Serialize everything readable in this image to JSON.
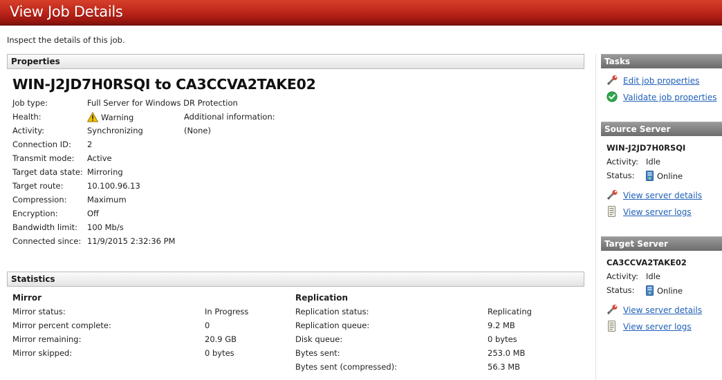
{
  "window": {
    "title": "View Job Details"
  },
  "intro": "Inspect the details of this job.",
  "properties": {
    "header": "Properties",
    "job_name": "WIN-J2JD7H0RSQI to CA3CCVA2TAKE02",
    "rows": [
      {
        "label": "Job type:",
        "value": "Full Server for Windows DR Protection"
      },
      {
        "label": "Health:",
        "value": "Warning",
        "icon": "warning-icon"
      },
      {
        "label": "Activity:",
        "value": "Synchronizing"
      },
      {
        "label": "Connection ID:",
        "value": "2"
      },
      {
        "label": "Transmit mode:",
        "value": "Active"
      },
      {
        "label": "Target data state:",
        "value": "Mirroring"
      },
      {
        "label": "Target route:",
        "value": "10.100.96.13"
      },
      {
        "label": "Compression:",
        "value": "Maximum"
      },
      {
        "label": "Encryption:",
        "value": "Off"
      },
      {
        "label": "Bandwidth limit:",
        "value": "100 Mb/s"
      },
      {
        "label": "Connected since:",
        "value": "11/9/2015 2:32:36 PM"
      }
    ],
    "additional_label": "Additional information:",
    "additional_value": "(None)"
  },
  "statistics": {
    "header": "Statistics",
    "mirror": {
      "title": "Mirror",
      "rows": [
        {
          "label": "Mirror status:",
          "value": "In Progress"
        },
        {
          "label": "Mirror percent complete:",
          "value": "0"
        },
        {
          "label": "Mirror remaining:",
          "value": "20.9 GB"
        },
        {
          "label": "Mirror skipped:",
          "value": "0 bytes"
        }
      ]
    },
    "replication": {
      "title": "Replication",
      "rows": [
        {
          "label": "Replication status:",
          "value": "Replicating"
        },
        {
          "label": "Replication queue:",
          "value": "9.2 MB"
        },
        {
          "label": "Disk queue:",
          "value": "0 bytes"
        },
        {
          "label": "Bytes sent:",
          "value": "253.0 MB"
        },
        {
          "label": "Bytes sent (compressed):",
          "value": "56.3 MB"
        }
      ]
    }
  },
  "tasks": {
    "header": "Tasks",
    "links": [
      {
        "label": "Edit job properties",
        "icon": "wrench-icon"
      },
      {
        "label": "Validate job properties",
        "icon": "check-icon"
      }
    ]
  },
  "source_server": {
    "header": "Source Server",
    "name": "WIN-J2JD7H0RSQI",
    "activity_label": "Activity:",
    "activity": "Idle",
    "status_label": "Status:",
    "status": "Online",
    "links": [
      {
        "label": "View server details",
        "icon": "wrench-icon"
      },
      {
        "label": "View server logs",
        "icon": "log-icon"
      }
    ]
  },
  "target_server": {
    "header": "Target Server",
    "name": "CA3CCVA2TAKE02",
    "activity_label": "Activity:",
    "activity": "Idle",
    "status_label": "Status:",
    "status": "Online",
    "links": [
      {
        "label": "View server details",
        "icon": "wrench-icon"
      },
      {
        "label": "View server logs",
        "icon": "log-icon"
      }
    ]
  },
  "colors": {
    "title_bar": "#c0281b",
    "link": "#1f5fb8",
    "sidebar_header": "#7c7c7c",
    "warning": "#f2c200",
    "success": "#2fa84a"
  }
}
